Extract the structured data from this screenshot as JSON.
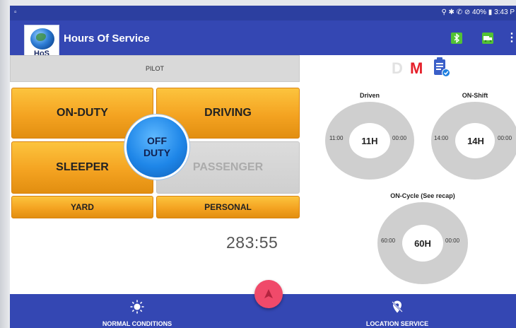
{
  "status_bar": {
    "left_icon": "notification-icon",
    "right_text": "⚲ ✱ ✆ ⊘ 40% ▮ 3:43 P"
  },
  "app": {
    "title": "Hours Of Service",
    "logo_text": "HoS"
  },
  "duty": {
    "pilot_label": "PILOT",
    "on_duty": "ON-DUTY",
    "driving": "DRIVING",
    "sleeper": "SLEEPER",
    "passenger": "PASSENGER",
    "yard": "YARD",
    "personal": "PERSONAL",
    "off_duty_line1": "OFF",
    "off_duty_line2": "DUTY",
    "timer": "283:55"
  },
  "mode": {
    "d": "D",
    "m": "M"
  },
  "gauges": {
    "driven": {
      "title": "Driven",
      "left": "11:00",
      "center": "11H",
      "right": "00:00"
    },
    "on_shift": {
      "title": "ON-Shift",
      "left": "14:00",
      "center": "14H",
      "right": "00:00"
    },
    "on_cycle": {
      "title": "ON-Cycle (See recap)",
      "left": "60:00",
      "center": "60H",
      "right": "00:00"
    }
  },
  "bottom_nav": {
    "left_label": "NORMAL CONDITIONS",
    "right_label": "LOCATION SERVICE"
  },
  "colors": {
    "primary": "#3447b3",
    "status_bar": "#2c3fa0",
    "orange_button": "#f4a321",
    "off_duty_blue": "#1e86e8",
    "accent_red": "#e5202a",
    "fab_pink": "#f04a6a"
  }
}
